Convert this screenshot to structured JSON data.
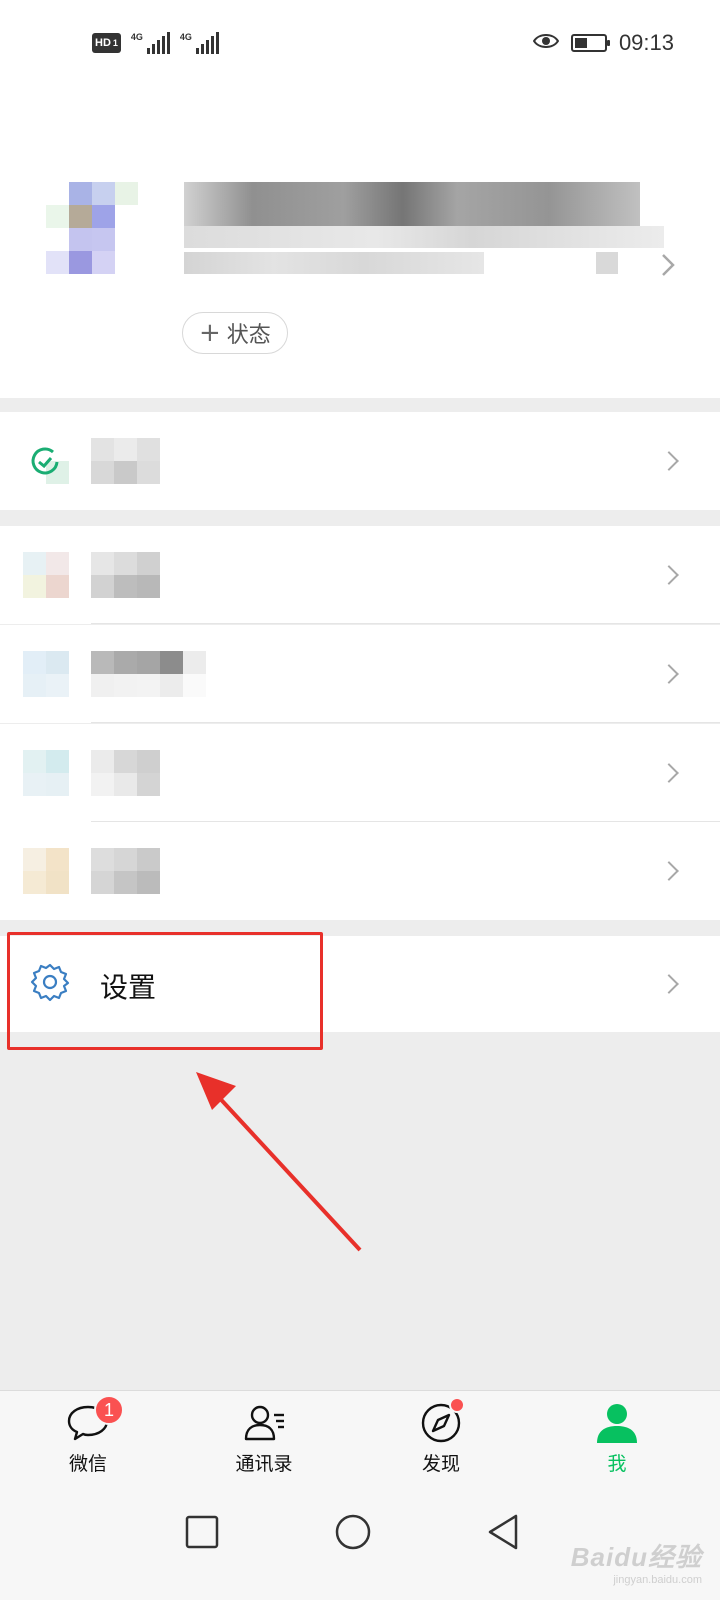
{
  "status_bar": {
    "hd_label": "HD",
    "sim_label": "1",
    "network_1": "4G",
    "network_2": "4G",
    "time": "09:13",
    "icons": [
      "eye-icon",
      "battery-icon"
    ]
  },
  "profile": {
    "status_label": "状态",
    "status_plus": "+"
  },
  "settings": {
    "label": "设置",
    "icon": "gear-icon"
  },
  "tabs": [
    {
      "label": "微信",
      "icon": "chat-bubble-icon",
      "badge": "1"
    },
    {
      "label": "通讯录",
      "icon": "contacts-icon"
    },
    {
      "label": "发现",
      "icon": "compass-icon",
      "dot": true
    },
    {
      "label": "我",
      "icon": "person-icon",
      "active": true
    }
  ],
  "nav": [
    "recent-apps-icon",
    "home-icon",
    "back-icon"
  ],
  "watermark": {
    "logo": "Baidu经验",
    "sub": "jingyan.baidu.com"
  },
  "colors": {
    "accent": "#07c160",
    "badge": "#fa5151",
    "highlight": "#e8302a",
    "settings_icon": "#3a7ec2"
  }
}
